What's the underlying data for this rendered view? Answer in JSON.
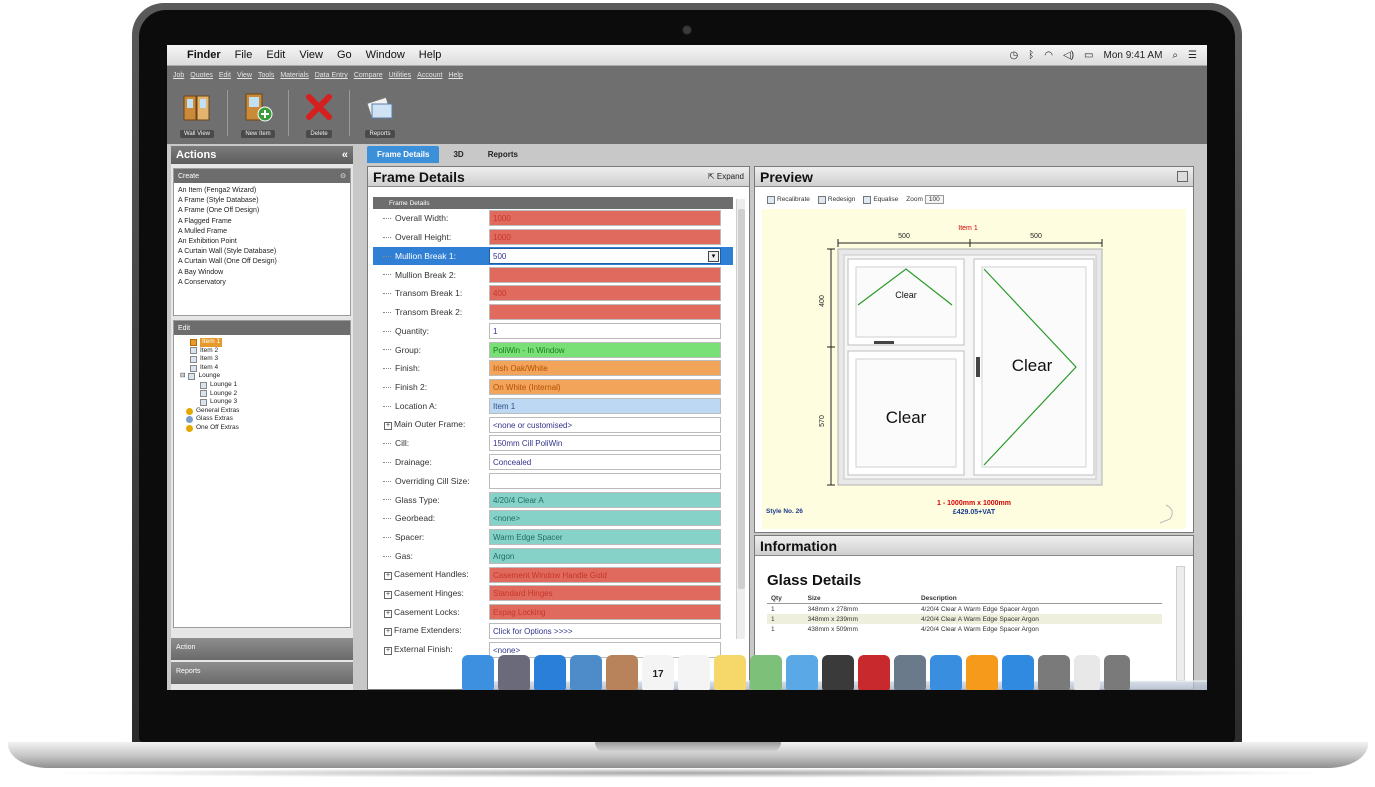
{
  "menubar": {
    "items": [
      "Finder",
      "File",
      "Edit",
      "View",
      "Go",
      "Window",
      "Help"
    ],
    "clock": "Mon 9:41 AM"
  },
  "app": {
    "menu": [
      "Job",
      "Quotes",
      "Edit",
      "View",
      "Tools",
      "Materials",
      "Data Entry",
      "Compare",
      "Utilities",
      "Account",
      "Help"
    ],
    "toolbar": [
      {
        "label": "Wall View",
        "icon": "wall-view-icon"
      },
      {
        "label": "New Item",
        "icon": "new-item-icon"
      },
      {
        "label": "Delete",
        "icon": "delete-icon"
      },
      {
        "label": "Reports",
        "icon": "reports-icon"
      }
    ]
  },
  "sidebar": {
    "title": "Actions",
    "create_title": "Create",
    "create_items": [
      "An Item (Fenga2 Wizard)",
      "A Frame (Style Database)",
      "A Frame (One Off Design)",
      "A Flagged Frame",
      "A Mulled Frame",
      "An Exhibition Point",
      "A Curtain Wall (Style Database)",
      "A Curtain Wall (One Off Design)",
      "A Bay Window",
      "A Conservatory"
    ],
    "edit_title": "Edit",
    "tree": [
      {
        "label": "Item 1",
        "level": 1,
        "selected": true
      },
      {
        "label": "Item 2",
        "level": 1
      },
      {
        "label": "Item 3",
        "level": 1
      },
      {
        "label": "Item 4",
        "level": 1
      },
      {
        "label": "Lounge",
        "level": 0
      },
      {
        "label": "Lounge 1",
        "level": 2
      },
      {
        "label": "Lounge 2",
        "level": 2
      },
      {
        "label": "Lounge 3",
        "level": 2
      },
      {
        "label": "General Extras",
        "level": 0
      },
      {
        "label": "Glass Extras",
        "level": 0
      },
      {
        "label": "One Off Extras",
        "level": 0
      }
    ],
    "bottom_buttons": [
      "Action",
      "Reports"
    ]
  },
  "tabs": [
    "Frame Details",
    "3D",
    "Reports"
  ],
  "frame_details": {
    "title": "Frame Details",
    "expand_label": "Expand",
    "group_header": "Frame Details",
    "rows": [
      {
        "label": "Overall Width:",
        "value": "1000",
        "color": "red"
      },
      {
        "label": "Overall Height:",
        "value": "1000",
        "color": "red"
      },
      {
        "label": "Mullion Break 1:",
        "value": "500",
        "color": "white",
        "selected": true
      },
      {
        "label": "Mullion Break 2:",
        "value": "",
        "color": "red"
      },
      {
        "label": "Transom Break 1:",
        "value": "400",
        "color": "red"
      },
      {
        "label": "Transom Break 2:",
        "value": "",
        "color": "red"
      },
      {
        "label": "Quantity:",
        "value": "1",
        "color": "white"
      },
      {
        "label": "Group:",
        "value": "PoliWin - In Window",
        "color": "green"
      },
      {
        "label": "Finish:",
        "value": "Irish Oak/White",
        "color": "orange"
      },
      {
        "label": "Finish 2:",
        "value": "On White (Internal)",
        "color": "orange"
      },
      {
        "label": "Location A:",
        "value": "Item 1",
        "color": "blue"
      },
      {
        "label": "Main Outer Frame:",
        "value": "<none or customised>",
        "color": "white",
        "expand": true
      },
      {
        "label": "Cill:",
        "value": "150mm Cill PoliWin",
        "color": "white"
      },
      {
        "label": "Drainage:",
        "value": "Concealed",
        "color": "white"
      },
      {
        "label": "Overriding Cill Size:",
        "value": "",
        "color": "white"
      },
      {
        "label": "Glass Type:",
        "value": "4/20/4 Clear A",
        "color": "teal"
      },
      {
        "label": "Georbead:",
        "value": "<none>",
        "color": "teal"
      },
      {
        "label": "Spacer:",
        "value": "Warm Edge Spacer",
        "color": "teal"
      },
      {
        "label": "Gas:",
        "value": "Argon",
        "color": "teal"
      },
      {
        "label": "Casement Handles:",
        "value": "Casement Window Handle Gold",
        "color": "red",
        "expand": true
      },
      {
        "label": "Casement Hinges:",
        "value": "Standard Hinges",
        "color": "red",
        "expand": true
      },
      {
        "label": "Casement Locks:",
        "value": "Espag Locking",
        "color": "red",
        "expand": true
      },
      {
        "label": "Frame Extenders:",
        "value": "Click for Options >>>>",
        "color": "white",
        "expand": true
      },
      {
        "label": "External Finish:",
        "value": "<none>",
        "color": "white",
        "expand": true
      }
    ]
  },
  "preview": {
    "title": "Preview",
    "tools": [
      "Recalibrate",
      "Redesign",
      "Equalise"
    ],
    "zoom_label": "Zoom",
    "zoom_value": "100",
    "item_label": "Item 1",
    "dim_left": "500",
    "dim_right": "500",
    "dim_top_v": "400",
    "dim_bottom_v": "570",
    "glass_labels": [
      "Clear",
      "Clear",
      "Clear"
    ],
    "style_label": "Style No. 26",
    "size_text": "1 - 1000mm x 1000mm",
    "price_text": "£429.05+VAT"
  },
  "information": {
    "title": "Information",
    "glass_title": "Glass Details",
    "columns": [
      "Qty",
      "Size",
      "Description"
    ],
    "rows": [
      [
        "1",
        "348mm x 278mm",
        "4/20/4 Clear A Warm Edge Spacer Argon"
      ],
      [
        "1",
        "348mm x 239mm",
        "4/20/4 Clear A Warm Edge Spacer Argon"
      ],
      [
        "1",
        "438mm x 509mm",
        "4/20/4 Clear A Warm Edge Spacer Argon"
      ]
    ]
  },
  "dock": {
    "calendar_day": "17",
    "icons": [
      "finder-icon",
      "launchpad-icon",
      "safari-icon",
      "mail-icon",
      "contacts-icon",
      "calendar-icon",
      "reminders-icon",
      "notes-icon",
      "maps-icon",
      "messages-icon",
      "facetime-icon",
      "photo-booth-icon",
      "iphoto-icon",
      "itunes-icon",
      "ibooks-icon",
      "app-store-icon",
      "system-preferences-icon",
      "documents-icon",
      "trash-icon"
    ],
    "colors": [
      "#3d8fe0",
      "#6a6a7a",
      "#2a7fd8",
      "#4d8cc8",
      "#b8835a",
      "#f4f4f4",
      "#f4f4f4",
      "#f6d86a",
      "#7cc07a",
      "#5aa9e6",
      "#3a3a3a",
      "#c8292c",
      "#6a7a8a",
      "#3a8ee0",
      "#f59a1b",
      "#2f8ae0",
      "#7a7a7a",
      "#e8e8e8",
      "#7a7a7a"
    ]
  },
  "colors": {
    "selection": "#2f7fd4",
    "tab_active": "#3c8fd9",
    "canvas": "#fefde0",
    "dim_red": "#d10000"
  }
}
